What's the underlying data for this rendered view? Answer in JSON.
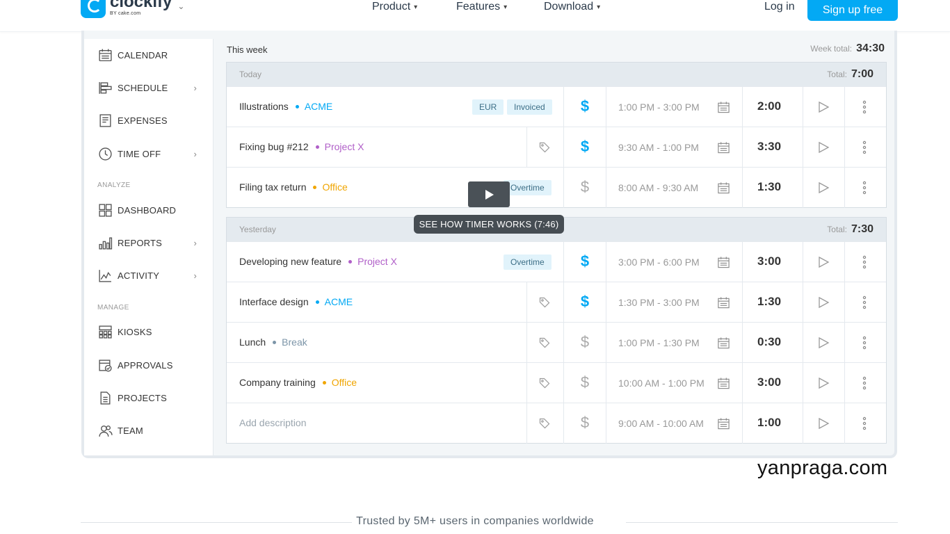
{
  "brand": {
    "name": "clockify",
    "sub": "BY cake.com",
    "accent": "#03a9f4"
  },
  "nav": {
    "items": [
      {
        "label": "Product"
      },
      {
        "label": "Features"
      },
      {
        "label": "Download"
      }
    ],
    "login": "Log in",
    "signup": "Sign up free"
  },
  "sidebar": {
    "items": [
      {
        "label": "CALENDAR",
        "icon": "calendar-icon"
      },
      {
        "label": "SCHEDULE",
        "icon": "schedule-icon",
        "chevron": true
      },
      {
        "label": "EXPENSES",
        "icon": "expenses-icon"
      },
      {
        "label": "TIME OFF",
        "icon": "time-off-icon",
        "chevron": true
      }
    ],
    "analyze_label": "ANALYZE",
    "analyze": [
      {
        "label": "DASHBOARD",
        "icon": "dashboard-icon"
      },
      {
        "label": "REPORTS",
        "icon": "reports-icon",
        "chevron": true
      },
      {
        "label": "ACTIVITY",
        "icon": "activity-icon",
        "chevron": true
      }
    ],
    "manage_label": "MANAGE",
    "manage": [
      {
        "label": "KIOSKS",
        "icon": "kiosks-icon"
      },
      {
        "label": "APPROVALS",
        "icon": "approvals-icon"
      },
      {
        "label": "PROJECTS",
        "icon": "projects-icon"
      },
      {
        "label": "TEAM",
        "icon": "team-icon"
      }
    ]
  },
  "week": {
    "label": "This week",
    "total_label": "Week total:",
    "total": "34:30"
  },
  "groups": [
    {
      "day": "Today",
      "total_label": "Total:",
      "total": "7:00",
      "entries": [
        {
          "desc": "Illustrations",
          "project": "ACME",
          "project_color": "#03a9f4",
          "badges": [
            "EUR",
            "Invoiced"
          ],
          "tag": false,
          "billable": true,
          "range": "1:00 PM - 3:00 PM",
          "duration": "2:00"
        },
        {
          "desc": "Fixing bug #212",
          "project": "Project X",
          "project_color": "#b05fc8",
          "badges": [],
          "tag": true,
          "billable": true,
          "range": "9:30 AM - 1:00 PM",
          "duration": "3:30"
        },
        {
          "desc": "Filing tax return",
          "project": "Office",
          "project_color": "#f0a500",
          "badges": [
            "Overtime"
          ],
          "tag": false,
          "billable": false,
          "range": "8:00 AM - 9:30 AM",
          "duration": "1:30"
        }
      ]
    },
    {
      "day": "Yesterday",
      "total_label": "Total:",
      "total": "7:30",
      "entries": [
        {
          "desc": "Developing new feature",
          "project": "Project X",
          "project_color": "#b05fc8",
          "badges": [
            "Overtime"
          ],
          "tag": false,
          "billable": true,
          "range": "3:00 PM - 6:00 PM",
          "duration": "3:00"
        },
        {
          "desc": "Interface design",
          "project": "ACME",
          "project_color": "#03a9f4",
          "badges": [],
          "tag": true,
          "billable": true,
          "range": "1:30 PM - 3:00 PM",
          "duration": "1:30"
        },
        {
          "desc": "Lunch",
          "project": "Break",
          "project_color": "#7c95a8",
          "badges": [],
          "tag": true,
          "billable": false,
          "range": "1:00 PM - 1:30 PM",
          "duration": "0:30"
        },
        {
          "desc": "Company training",
          "project": "Office",
          "project_color": "#f0a500",
          "badges": [],
          "tag": true,
          "billable": false,
          "range": "10:00 AM - 1:00 PM",
          "duration": "3:00"
        },
        {
          "desc": "",
          "placeholder": "Add description",
          "project": "",
          "project_color": "",
          "badges": [],
          "tag": true,
          "billable": false,
          "range": "9:00 AM - 10:00 AM",
          "duration": "1:00"
        }
      ]
    }
  ],
  "video": {
    "tooltip": "SEE HOW TIMER WORKS (7:46)"
  },
  "watermark": "yanpraga.com",
  "trusted": "Trusted by 5M+ users in companies worldwide"
}
